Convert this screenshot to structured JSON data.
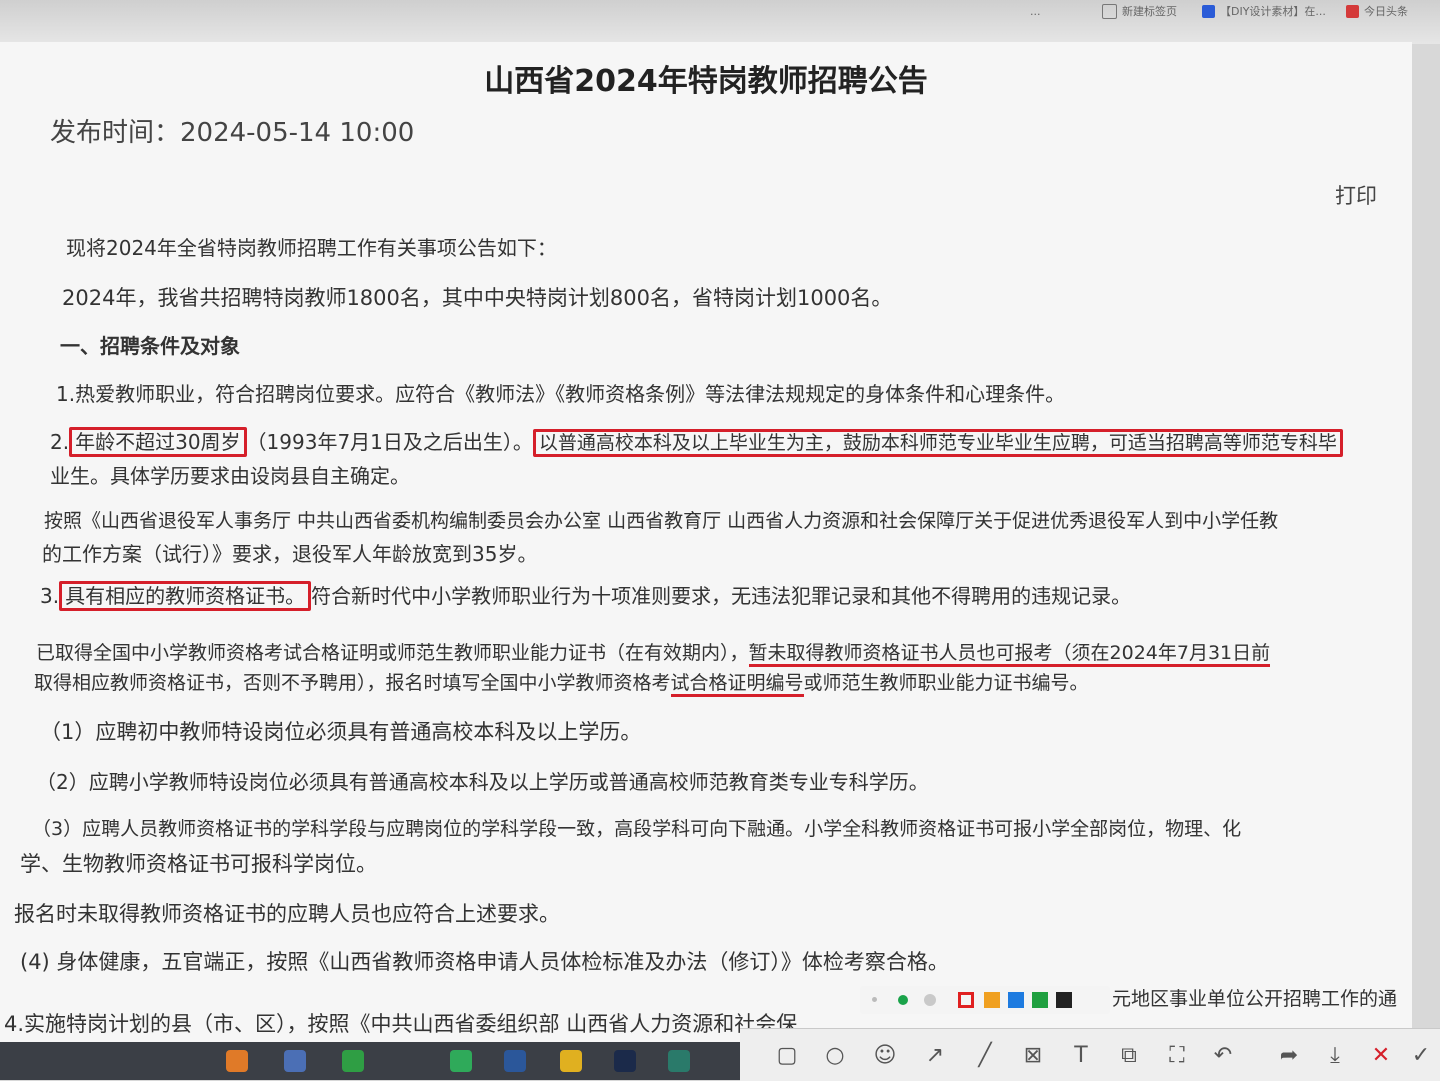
{
  "browser_tabs": [
    {
      "label": "...",
      "icon": "browser-tab-icon"
    },
    {
      "label": "新建标签页",
      "icon": "new-tab-icon"
    },
    {
      "label": "【DIY设计素材】在...",
      "icon": "design-site-icon"
    },
    {
      "label": "今日头条",
      "icon": "toutiao-icon"
    }
  ],
  "doc": {
    "title": "山西省2024年特岗教师招聘公告",
    "publish_time": "发布时间：2024-05-14 10:00",
    "print_label": "打印",
    "intro": "现将2024年全省特岗教师招聘工作有关事项公告如下：",
    "summary": "2024年，我省共招聘特岗教师1800名，其中中央特岗计划800名，省特岗计划1000名。",
    "section1_heading": "一、招聘条件及对象",
    "item1": "1.热爱教师职业，符合招聘岗位要求。应符合《教师法》《教师资格条例》等法律法规规定的身体条件和心理条件。",
    "item2_prefix": "2.",
    "item2_age": "年龄不超过30周岁",
    "item2_birth": "（1993年7月1日及之后出生）。",
    "item2_degree": "以普通高校本科及以上毕业生为主，鼓励本科师范专业毕业生应聘，可适当招聘高等师范专科毕",
    "item2_cont": "业生。具体学历要求由设岗县自主确定。",
    "veteran_line1": "按照《山西省退役军人事务厅 中共山西省委机构编制委员会办公室 山西省教育厅 山西省人力资源和社会保障厅关于促进优秀退役军人到中小学任教",
    "veteran_line2": "的工作方案（试行）》要求，退役军人年龄放宽到35岁。",
    "item3_prefix": "3.",
    "item3_cert": "具有相应的教师资格证书。",
    "item3_rest": "符合新时代中小学教师职业行为十项准则要求，无违法犯罪记录和其他不得聘用的违规记录。",
    "cert_line1_a": "已取得全国中小学教师资格考试合格证明或师范生教师职业能力证书（在有效期内），",
    "cert_line1_b": "暂未取得教师资格证书人员也可报考（须在2024年7月31日前",
    "cert_line2_a": "取得相应教师资格证书，否则不予聘用），报名时填写全国中小学教师资格考",
    "cert_line2_b": "试合格证明编号",
    "cert_line2_c": "或师范生教师职业能力证书编号。",
    "sub1": "（1）应聘初中教师特设岗位必须具有普通高校本科及以上学历。",
    "sub2": "（2）应聘小学教师特设岗位必须具有普通高校本科及以上学历或普通高校师范教育类专业专科学历。",
    "sub3_line1": "（3）应聘人员教师资格证书的学科学段与应聘岗位的学科学段一致，高段学科可向下融通。小学全科教师资格证书可报小学全部岗位，物理、化",
    "sub3_line2": "学、生物教师资格证书可报科学岗位。",
    "no_cert_note": "报名时未取得教师资格证书的应聘人员也应符合上述要求。",
    "sub4": "(4) 身体健康，五官端正，按照《山西省教师资格申请人员体检标准及办法（修订）》体检考察合格。",
    "item4_partial": "4.实施特岗计划的县（市、区），按照《中共山西省委组织部 山西省人力资源和社会保",
    "item4_tail": "元地区事业单位公开招聘工作的通"
  },
  "colors": {
    "annotation_red": "#d51f2a",
    "palette": [
      "#e02020",
      "#f0a020",
      "#1e7be0",
      "#20a040",
      "#222222"
    ]
  },
  "annotation_toolbar": {
    "tools": [
      {
        "icon": "rectangle-icon",
        "glyph": "▢"
      },
      {
        "icon": "ellipse-icon",
        "glyph": "○"
      },
      {
        "icon": "emoji-icon",
        "glyph": "☺"
      },
      {
        "icon": "arrow-icon",
        "glyph": "↗"
      },
      {
        "icon": "pen-icon",
        "glyph": "╱"
      },
      {
        "icon": "mosaic-icon",
        "glyph": "⊠"
      },
      {
        "icon": "text-icon",
        "glyph": "T"
      },
      {
        "icon": "sticker-icon",
        "glyph": "⧉"
      },
      {
        "icon": "ocr-icon",
        "glyph": "⛶"
      },
      {
        "icon": "undo-icon",
        "glyph": "↶"
      },
      {
        "icon": "share-icon",
        "glyph": "➦"
      },
      {
        "icon": "download-icon",
        "glyph": "⤓"
      },
      {
        "icon": "close-icon",
        "glyph": "✕"
      },
      {
        "icon": "confirm-icon",
        "glyph": "✓"
      }
    ]
  }
}
